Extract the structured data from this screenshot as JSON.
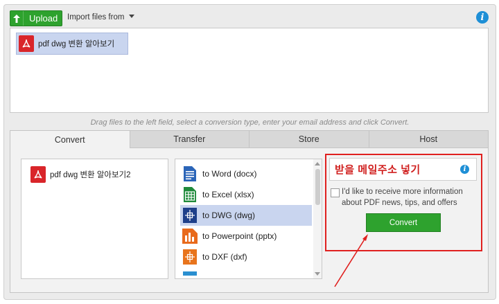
{
  "toolbar": {
    "upload_label": "Upload",
    "import_label": "Import files from"
  },
  "dropfield": {
    "file_name": "pdf dwg 변환 알아보기"
  },
  "hint": "Drag files to the left field, select a conversion type, enter your email address and click Convert.",
  "tabs": [
    {
      "label": "Convert",
      "active": true
    },
    {
      "label": "Transfer",
      "active": false
    },
    {
      "label": "Store",
      "active": false
    },
    {
      "label": "Host",
      "active": false
    }
  ],
  "convert_panel": {
    "selected_file": "pdf dwg 변환 알아보기2",
    "formats": [
      {
        "label": "to Word (docx)",
        "icon": "word-icon",
        "selected": false
      },
      {
        "label": "to Excel (xlsx)",
        "icon": "excel-icon",
        "selected": false
      },
      {
        "label": "to DWG (dwg)",
        "icon": "dwg-icon",
        "selected": true
      },
      {
        "label": "to Powerpoint (pptx)",
        "icon": "powerpoint-icon",
        "selected": false
      },
      {
        "label": "to DXF (dxf)",
        "icon": "dxf-icon",
        "selected": false
      }
    ],
    "email_annotation": "받을 메일주소 넣기",
    "newsletter_text": "I'd like to receive more information about PDF news, tips, and offers",
    "convert_label": "Convert"
  },
  "colors": {
    "green": "#2ea22e",
    "red_annotation": "#e0201f",
    "info_blue": "#1e8fd6",
    "selection": "#c9d5ef"
  }
}
